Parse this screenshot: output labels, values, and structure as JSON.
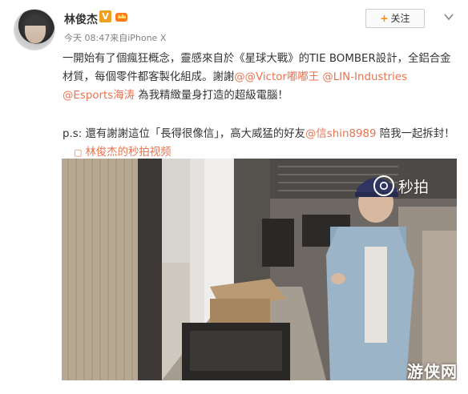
{
  "author": {
    "name": "林俊杰",
    "verified_badge": "V",
    "post_meta": "今天 08:47来自iPhone X"
  },
  "follow_button": {
    "label": "关注",
    "plus": "+"
  },
  "post": {
    "line1_text": "一開始有了個瘋狂概念，靈感來自於《星球大戰》的TIE BOMBER設計，全鋁合金材質，每個零件都客製化組成。謝謝",
    "mention_victor": "@@Victor嘟嘟王",
    "mention_lin": "@LIN-Industries",
    "mention_esports": "@Esports海涛",
    "line1_end": " 為我精緻量身打造的超級電腦！",
    "ps_text": "p.s: 還有謝謝這位「長得很像信」，高大威猛的好友",
    "mention_shin": "@信shin8989",
    "ps_end": " 陪我一起拆封！",
    "video_link": "林俊杰的秒拍视频"
  },
  "video": {
    "watermark": "秒拍",
    "corner_watermark": "游侠网"
  },
  "colors": {
    "link": "#eb7350",
    "follow_plus": "#ff8200",
    "meta": "#808080"
  }
}
